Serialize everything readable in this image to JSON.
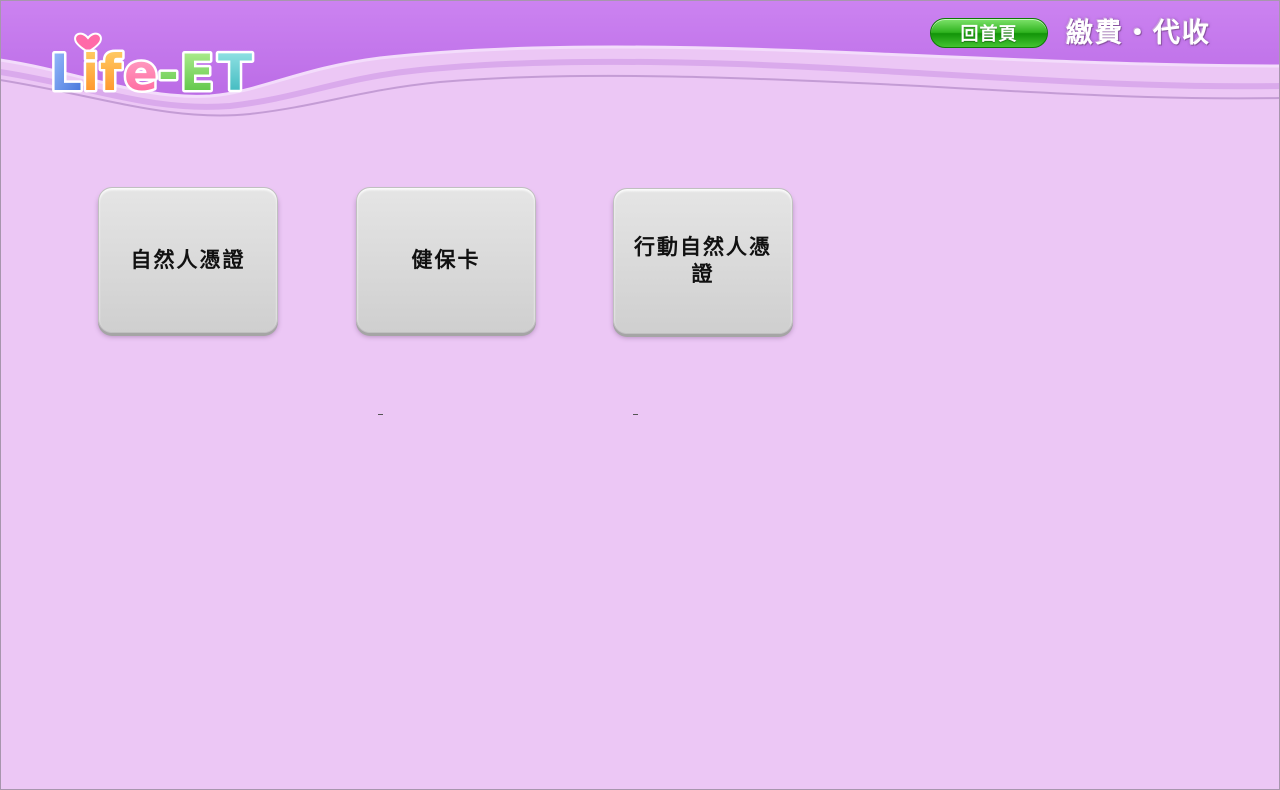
{
  "header": {
    "logo_text": "Life-ET",
    "home_label": "回首頁",
    "title": "繳費・代收"
  },
  "options": [
    {
      "label": "自然人憑證"
    },
    {
      "label": "健保卡"
    },
    {
      "label": "行動自然人憑證"
    }
  ],
  "colors": {
    "background": "#ecc7f5",
    "header": "#c678ee",
    "home_button": "#2fb31f",
    "option_button": "#d8d8d8"
  }
}
